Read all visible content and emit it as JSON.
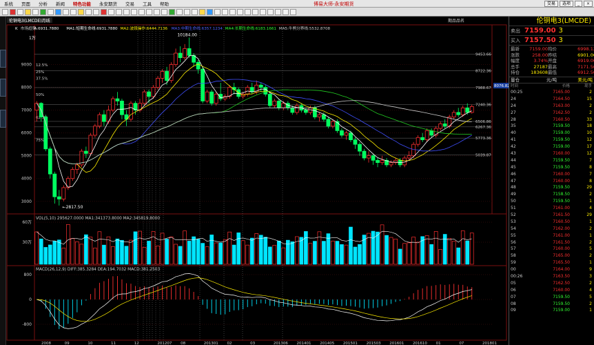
{
  "menu": [
    "系统",
    "页面",
    "分析",
    "新闻",
    "特色功能",
    "永安期货",
    "交易",
    "工具",
    "帮助"
  ],
  "active_menu": "特色功能",
  "app_title": "博易大师-永安期货",
  "win_buttons": [
    "交易",
    "选项"
  ],
  "chart_tab": "伦铜电3(LMCDE)月线",
  "ma_legend": {
    "k": "K",
    "series": "市场趋势",
    "a": "A:6931.7880",
    "ma1": "MA1:短期生命线:6931.7880",
    "ma2": "MA2:波段操作:6444.7136",
    "ma3": "MA3:中期生命线:6357.1234",
    "ma4": "MA4:长期生命线:6183.1661",
    "ma5": "MA5:牛熊分界线:5532.8708"
  },
  "top_labels": {
    "right": "期品品名",
    "hl": "10184.00",
    "unit": "1万"
  },
  "y_price": [
    "9000",
    "8000",
    "7000",
    "6000",
    "5000",
    "4000",
    "3000"
  ],
  "right_levels": [
    "9453.66",
    "8722.36",
    "7988.67",
    "7240.36",
    "6506.86",
    "6267.36",
    "5773.36",
    "5039.87"
  ],
  "pct_labels": [
    "12.5%",
    "25%",
    "37.5%",
    "50%",
    "62.5%",
    "75%"
  ],
  "low_label": "2817.50",
  "cur_price": "8076.82",
  "vol_legend": "VOL(5,10) 295627.0000 MA1:341373.8000 MA2:345819.8000",
  "vol_ticks": [
    "60万",
    "30万"
  ],
  "macd_legend": "MACD(26,12,9) DIFF:385.3284 DEA:194.7032 MACD:381.2503",
  "macd_ticks": [
    "800",
    "0",
    "-800"
  ],
  "x_dates": [
    "2008",
    "09",
    "10",
    "11",
    "12",
    "201207",
    "08",
    "201301",
    "02",
    "03",
    "201306",
    "201401",
    "201405",
    "201501",
    "201503",
    "201601",
    "201610",
    "01",
    "07",
    "201801"
  ],
  "right_panel": {
    "title": "伦铜电3(LMCDE)",
    "sell_label": "卖出",
    "sell_price": "7159.00",
    "sell_vol": "3",
    "buy_label": "买入",
    "buy_price": "7157.50",
    "buy_vol": "3",
    "quote": [
      [
        "最新",
        "7159.00",
        "均价",
        "6998.12"
      ],
      [
        "涨跌",
        "258.00",
        "昨结",
        "6901.00"
      ],
      [
        "幅度",
        "3.74%",
        "开盘",
        "6919.00"
      ],
      [
        "总手",
        "27187",
        "最高",
        "7171.50"
      ],
      [
        "持仓",
        "183608",
        "最低",
        "6912.50"
      ]
    ],
    "hdr": [
      "量仓",
      "元/吨",
      "美元/吨"
    ],
    "sub": [
      "时间",
      "价格",
      "现手"
    ],
    "ticks": [
      [
        "00:25",
        "7165.00",
        "2"
      ],
      [
        "24",
        "7164.50",
        "15"
      ],
      [
        "24",
        "7163.00",
        "2"
      ],
      [
        "27",
        "7162.50",
        "2"
      ],
      [
        "28",
        "7160.50",
        "33"
      ],
      [
        "35",
        "7159.50",
        "18"
      ],
      [
        "40",
        "7159.00",
        "10"
      ],
      [
        "41",
        "7159.50",
        "12"
      ],
      [
        "42",
        "7159.00",
        "17"
      ],
      [
        "43",
        "7160.00",
        "12"
      ],
      [
        "44",
        "7159.50",
        "7"
      ],
      [
        "45",
        "7159.50",
        "8"
      ],
      [
        "46",
        "7160.00",
        "7"
      ],
      [
        "47",
        "7160.00",
        "8"
      ],
      [
        "48",
        "7159.50",
        "29"
      ],
      [
        "49",
        "7158.50",
        "2"
      ],
      [
        "50",
        "7159.50",
        "1"
      ],
      [
        "51",
        "7161.00",
        "4"
      ],
      [
        "52",
        "7161.50",
        "29"
      ],
      [
        "53",
        "7160.50",
        "1"
      ],
      [
        "54",
        "7162.00",
        "2"
      ],
      [
        "55",
        "7161.00",
        "1"
      ],
      [
        "56",
        "7161.50",
        "2"
      ],
      [
        "57",
        "7160.00",
        "5"
      ],
      [
        "58",
        "7165.00",
        "2"
      ],
      [
        "59",
        "7165.50",
        "1"
      ],
      [
        "00",
        "7164.00",
        "9"
      ],
      [
        "00:26",
        "7163.50",
        "3"
      ],
      [
        "05",
        "7162.50",
        "2"
      ],
      [
        "06",
        "7160.00",
        "4"
      ],
      [
        "07",
        "7159.50",
        "5"
      ],
      [
        "08",
        "7159.50",
        "2"
      ],
      [
        "09",
        "7159.00",
        "1"
      ]
    ]
  },
  "chart_data": {
    "type": "candlestick",
    "title": "伦铜电3(LMCDE) 月线",
    "ylim": [
      2600,
      10500
    ],
    "candles": [
      [
        7000,
        7300,
        7400,
        6500
      ],
      [
        7300,
        6700,
        7350,
        6500
      ],
      [
        6700,
        5300,
        6800,
        5200
      ],
      [
        5300,
        4200,
        5400,
        4000
      ],
      [
        4200,
        3200,
        4300,
        2900
      ],
      [
        3200,
        3100,
        3500,
        2817
      ],
      [
        3100,
        3600,
        3700,
        3000
      ],
      [
        3600,
        4000,
        4100,
        3500
      ],
      [
        4000,
        4400,
        4500,
        3900
      ],
      [
        4400,
        4600,
        4700,
        4200
      ],
      [
        4600,
        5200,
        5300,
        4500
      ],
      [
        5200,
        5100,
        5400,
        4900
      ],
      [
        5100,
        5900,
        6000,
        5000
      ],
      [
        5900,
        6300,
        6400,
        5800
      ],
      [
        6300,
        6800,
        6900,
        6200
      ],
      [
        6800,
        6500,
        7000,
        6300
      ],
      [
        6500,
        7000,
        7200,
        6400
      ],
      [
        7000,
        7500,
        7600,
        6900
      ],
      [
        7500,
        7400,
        7800,
        7200
      ],
      [
        7400,
        6800,
        7500,
        6600
      ],
      [
        6800,
        6600,
        7000,
        6300
      ],
      [
        6600,
        7300,
        7400,
        6500
      ],
      [
        7300,
        7000,
        7400,
        6800
      ],
      [
        7000,
        7300,
        7500,
        6900
      ],
      [
        7300,
        7800,
        7900,
        7200
      ],
      [
        7800,
        7600,
        7900,
        7300
      ],
      [
        7600,
        8000,
        8100,
        7500
      ],
      [
        8000,
        8400,
        8500,
        7900
      ],
      [
        8400,
        8700,
        8800,
        8200
      ],
      [
        8700,
        8300,
        8900,
        8100
      ],
      [
        8300,
        9000,
        9100,
        8200
      ],
      [
        9000,
        9500,
        9700,
        8900
      ],
      [
        9500,
        9300,
        9800,
        9100
      ],
      [
        9300,
        9700,
        9900,
        9200
      ],
      [
        9700,
        9400,
        10184,
        9300
      ],
      [
        9400,
        9100,
        9500,
        8900
      ],
      [
        9100,
        8800,
        9200,
        8600
      ],
      [
        8800,
        7400,
        8900,
        7300
      ],
      [
        7400,
        7800,
        7900,
        7300
      ],
      [
        7800,
        7300,
        7900,
        7200
      ],
      [
        7300,
        7700,
        7800,
        7200
      ],
      [
        7700,
        7500,
        8200,
        7400
      ],
      [
        7500,
        7600,
        7700,
        7400
      ],
      [
        7600,
        8000,
        8100,
        7500
      ],
      [
        8000,
        7900,
        8200,
        7700
      ],
      [
        7900,
        7600,
        8000,
        7500
      ],
      [
        7600,
        7700,
        7800,
        7500
      ],
      [
        7700,
        8000,
        8100,
        7600
      ],
      [
        8000,
        7800,
        8200,
        7700
      ],
      [
        7800,
        8100,
        8300,
        7700
      ],
      [
        8100,
        8000,
        8200,
        7800
      ],
      [
        8000,
        7700,
        8100,
        7600
      ],
      [
        7700,
        7200,
        7800,
        7100
      ],
      [
        7200,
        7400,
        7500,
        7100
      ],
      [
        7400,
        7100,
        7500,
        7000
      ],
      [
        7100,
        7300,
        7400,
        7000
      ],
      [
        7300,
        7100,
        7400,
        7000
      ],
      [
        7100,
        6900,
        7200,
        6800
      ],
      [
        6900,
        7200,
        7300,
        6800
      ],
      [
        7200,
        7000,
        7300,
        6900
      ],
      [
        7000,
        6900,
        7100,
        6800
      ],
      [
        6900,
        7100,
        7200,
        6800
      ],
      [
        7100,
        6700,
        7200,
        6600
      ],
      [
        6700,
        6800,
        6900,
        6500
      ],
      [
        6800,
        6600,
        6900,
        6500
      ],
      [
        6600,
        6300,
        6700,
        6200
      ],
      [
        6300,
        6500,
        6600,
        6200
      ],
      [
        6500,
        6100,
        6600,
        6000
      ],
      [
        6100,
        5900,
        6200,
        5800
      ],
      [
        5900,
        6000,
        6100,
        5700
      ],
      [
        6000,
        5700,
        6100,
        5600
      ],
      [
        5700,
        5500,
        5800,
        5300
      ],
      [
        5500,
        5200,
        5600,
        5000
      ],
      [
        5200,
        4900,
        5300,
        4800
      ],
      [
        4900,
        5000,
        5200,
        4700
      ],
      [
        5000,
        4800,
        5100,
        4600
      ],
      [
        4800,
        4700,
        4900,
        4500
      ],
      [
        4700,
        4800,
        5000,
        4600
      ],
      [
        4800,
        4600,
        4900,
        4500
      ],
      [
        4600,
        4700,
        4800,
        4500
      ],
      [
        4700,
        4800,
        4900,
        4600
      ],
      [
        4800,
        4600,
        4900,
        4500
      ],
      [
        4600,
        4900,
        5000,
        4500
      ],
      [
        4900,
        5000,
        5200,
        4800
      ],
      [
        5000,
        5500,
        5600,
        4900
      ],
      [
        5500,
        5800,
        5900,
        5400
      ],
      [
        5800,
        5700,
        6000,
        5600
      ],
      [
        5700,
        6100,
        6200,
        5600
      ],
      [
        6100,
        5900,
        6200,
        5800
      ],
      [
        5900,
        6200,
        6300,
        5800
      ],
      [
        6200,
        6400,
        6500,
        6100
      ],
      [
        6400,
        6300,
        6600,
        6200
      ],
      [
        6300,
        6700,
        6800,
        6200
      ],
      [
        6700,
        6900,
        7000,
        6600
      ],
      [
        6900,
        6800,
        7100,
        6700
      ],
      [
        6800,
        7100,
        7200,
        6700
      ],
      [
        7100,
        6900,
        7300,
        6800
      ],
      [
        6900,
        7160,
        7240,
        6850
      ]
    ],
    "volume_max": 650000
  },
  "colors": {
    "up": "#ff3030",
    "down": "#00ff60",
    "vol": "#00e5ff",
    "grid": "#7a1010"
  }
}
